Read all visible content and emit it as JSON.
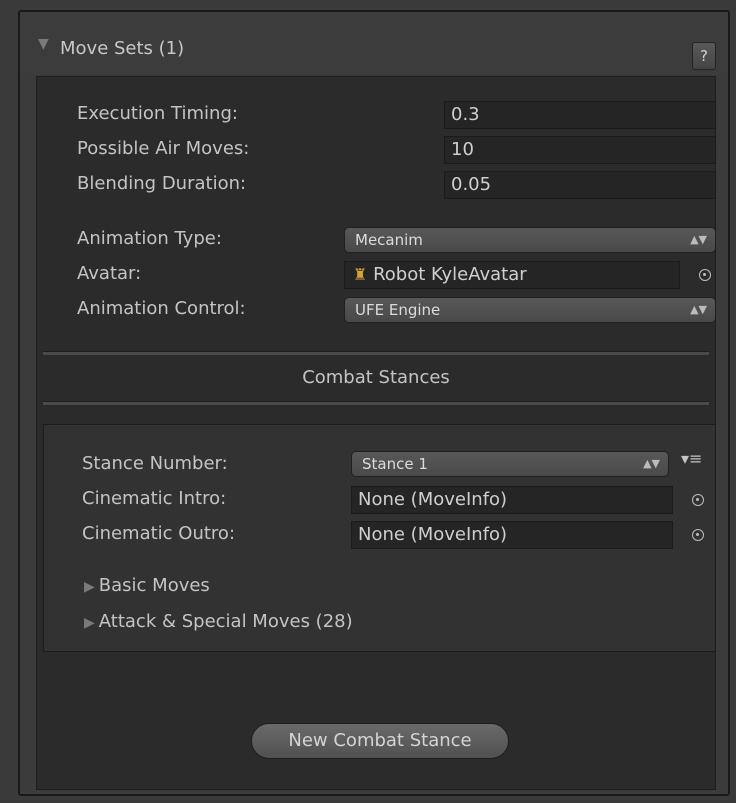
{
  "header": {
    "title": "Move Sets (1)",
    "help_label": "?"
  },
  "fields": {
    "execution_timing": {
      "label": "Execution Timing:",
      "value": "0.3"
    },
    "possible_air_moves": {
      "label": "Possible Air Moves:",
      "value": "10"
    },
    "blending_duration": {
      "label": "Blending Duration:",
      "value": "0.05"
    },
    "animation_type": {
      "label": "Animation Type:",
      "value": "Mecanim"
    },
    "avatar": {
      "label": "Avatar:",
      "value": "Robot KyleAvatar"
    },
    "animation_control": {
      "label": "Animation Control:",
      "value": "UFE Engine"
    }
  },
  "combat_stances": {
    "title": "Combat Stances",
    "stance_number": {
      "label": "Stance Number:",
      "value": "Stance 1"
    },
    "cinematic_intro": {
      "label": "Cinematic Intro:",
      "value": "None (MoveInfo)"
    },
    "cinematic_outro": {
      "label": "Cinematic Outro:",
      "value": "None (MoveInfo)"
    },
    "basic_moves_label": "Basic Moves",
    "attack_special_label": "Attack & Special Moves (28)"
  },
  "new_stance_button": "New Combat Stance"
}
